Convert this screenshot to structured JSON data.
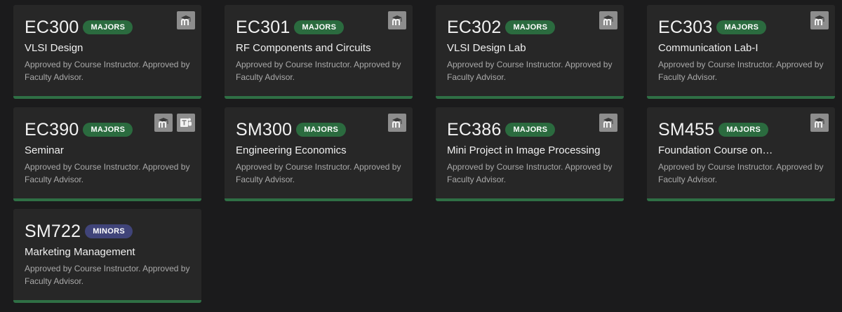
{
  "courses": [
    {
      "code": "EC300",
      "badge": "MAJORS",
      "badge_type": "majors",
      "title": "VLSI Design",
      "status": "Approved by Course Instructor. Approved by Faculty Advisor.",
      "icons": [
        "moodle-icon"
      ]
    },
    {
      "code": "EC301",
      "badge": "MAJORS",
      "badge_type": "majors",
      "title": "RF Components and Circuits",
      "status": "Approved by Course Instructor. Approved by Faculty Advisor.",
      "icons": [
        "moodle-icon"
      ]
    },
    {
      "code": "EC302",
      "badge": "MAJORS",
      "badge_type": "majors",
      "title": "VLSI Design Lab",
      "status": "Approved by Course Instructor. Approved by Faculty Advisor.",
      "icons": [
        "moodle-icon"
      ]
    },
    {
      "code": "EC303",
      "badge": "MAJORS",
      "badge_type": "majors",
      "title": "Communication Lab-I",
      "status": "Approved by Course Instructor. Approved by Faculty Advisor.",
      "icons": [
        "moodle-icon"
      ]
    },
    {
      "code": "EC390",
      "badge": "MAJORS",
      "badge_type": "majors",
      "title": "Seminar",
      "status": "Approved by Course Instructor. Approved by Faculty Advisor.",
      "icons": [
        "moodle-icon",
        "teams-icon"
      ]
    },
    {
      "code": "SM300",
      "badge": "MAJORS",
      "badge_type": "majors",
      "title": "Engineering Economics",
      "status": "Approved by Course Instructor. Approved by Faculty Advisor.",
      "icons": [
        "moodle-icon"
      ]
    },
    {
      "code": "EC386",
      "badge": "MAJORS",
      "badge_type": "majors",
      "title": "Mini Project in Image Processing",
      "status": "Approved by Course Instructor. Approved by Faculty Advisor.",
      "icons": [
        "moodle-icon"
      ]
    },
    {
      "code": "SM455",
      "badge": "MAJORS",
      "badge_type": "majors",
      "title": "Foundation Course on…",
      "status": "Approved by Course Instructor. Approved by Faculty Advisor.",
      "icons": [
        "moodle-icon"
      ]
    },
    {
      "code": "SM722",
      "badge": "MINORS",
      "badge_type": "minors",
      "title": "Marketing Management",
      "status": "Approved by Course Instructor. Approved by Faculty Advisor.",
      "icons": []
    }
  ],
  "colors": {
    "background": "#1b1b1c",
    "card": "#272727",
    "majors": "#2b6b3f",
    "minors": "#404479",
    "accent_bar": "#2f6f45"
  }
}
